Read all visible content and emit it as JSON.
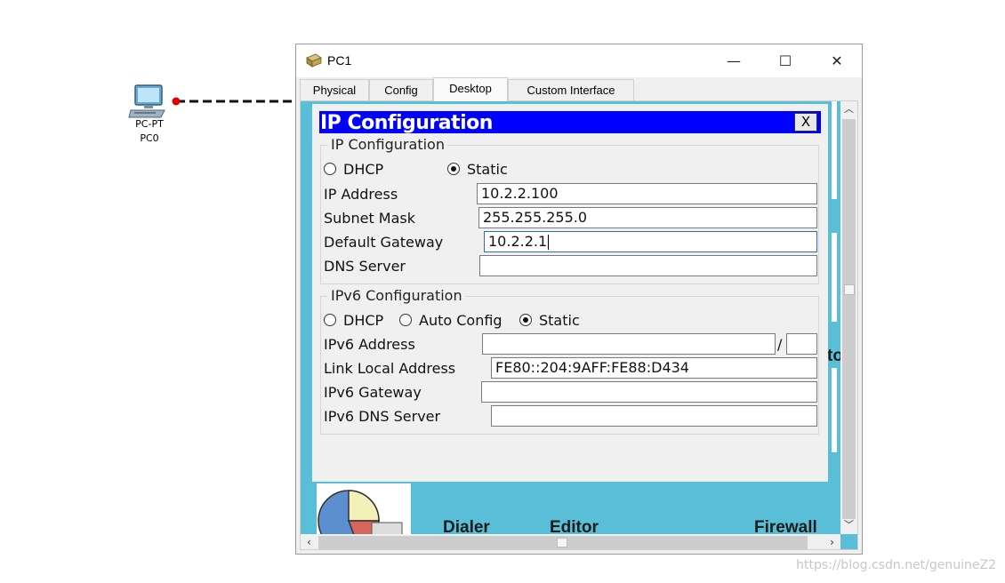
{
  "workspace": {
    "device_type": "PC-PT",
    "device_name": "PC0",
    "watermark": "https://blog.csdn.net/genuineZ2"
  },
  "window": {
    "title": "PC1",
    "minimize_glyph": "—",
    "maximize_glyph": "☐",
    "close_glyph": "✕"
  },
  "tabs": [
    {
      "label": "Physical"
    },
    {
      "label": "Config"
    },
    {
      "label": "Desktop",
      "active": true
    },
    {
      "label": "Custom Interface"
    }
  ],
  "desktop_background": {
    "apps": [
      "Dialer",
      "Editor",
      "Firewall"
    ],
    "side_text": "to"
  },
  "ip_dialog": {
    "title": "IP Configuration",
    "close_label": "X",
    "ipv4": {
      "group_label": "IP Configuration",
      "mode_dhcp": "DHCP",
      "mode_static": "Static",
      "selected_mode": "Static",
      "ip_address_label": "IP Address",
      "ip_address": "10.2.2.100",
      "subnet_mask_label": "Subnet Mask",
      "subnet_mask": "255.255.255.0",
      "default_gateway_label": "Default Gateway",
      "default_gateway": "10.2.2.1",
      "dns_server_label": "DNS Server",
      "dns_server": ""
    },
    "ipv6": {
      "group_label": "IPv6 Configuration",
      "mode_dhcp": "DHCP",
      "mode_auto": "Auto Config",
      "mode_static": "Static",
      "selected_mode": "Static",
      "ipv6_address_label": "IPv6 Address",
      "ipv6_address": "",
      "prefix_separator": "/",
      "prefix_length": "",
      "link_local_label": "Link Local Address",
      "link_local": "FE80::204:9AFF:FE88:D434",
      "ipv6_gateway_label": "IPv6 Gateway",
      "ipv6_gateway": "",
      "ipv6_dns_label": "IPv6 DNS Server",
      "ipv6_dns": ""
    }
  },
  "colors": {
    "dialog_title_bar": "#0000ff",
    "desktop_bg": "#59bfd8",
    "link_endpoint": "#e00000"
  }
}
